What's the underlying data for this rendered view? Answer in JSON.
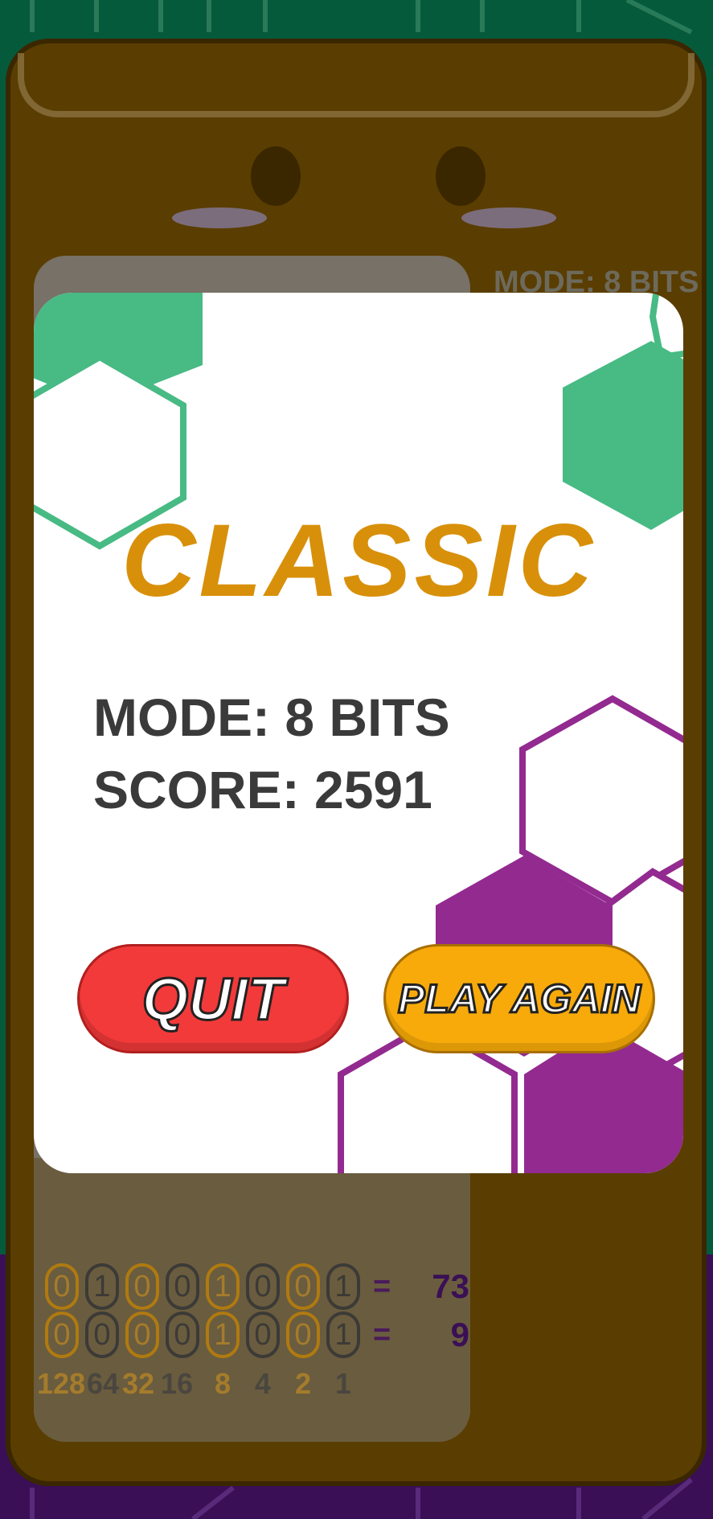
{
  "colors": {
    "accent_gold": "#d8900a",
    "quit_red": "#f23a3a",
    "play_again_orange": "#f7aa0a",
    "hex_green": "#48ba84",
    "hex_purple": "#932a90",
    "cabinet_brown": "#5a3d00"
  },
  "background": {
    "mode_label": "MODE: 8 BITS"
  },
  "board": {
    "rows": [
      {
        "bits": [
          "0",
          "1",
          "0",
          "0",
          "1",
          "0",
          "0",
          "1"
        ],
        "equals": "=",
        "value": "73"
      },
      {
        "bits": [
          "0",
          "0",
          "0",
          "0",
          "1",
          "0",
          "0",
          "1"
        ],
        "equals": "=",
        "value": "9"
      }
    ],
    "weights": [
      "128",
      "64",
      "32",
      "16",
      "8",
      "4",
      "2",
      "1"
    ]
  },
  "modal": {
    "title": "CLASSIC",
    "mode_line": "MODE: 8 BITS",
    "score_line": "SCORE: 2591",
    "quit_label": "QUIT",
    "play_again_label": "PLAY AGAIN"
  }
}
